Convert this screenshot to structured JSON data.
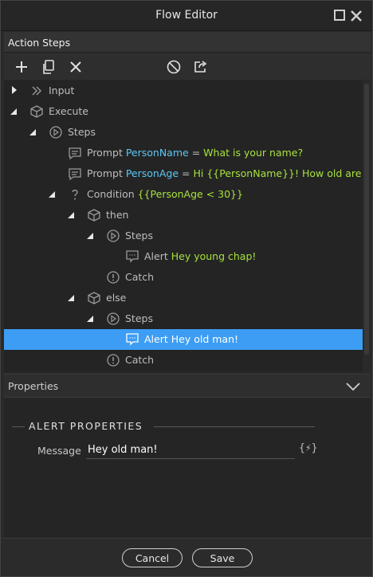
{
  "window": {
    "title": "Flow Editor"
  },
  "steps_panel": {
    "title": "Action Steps"
  },
  "toolbar": {
    "buttons": [
      {
        "icon": "plus-icon"
      },
      {
        "icon": "copy-icon"
      },
      {
        "icon": "close-icon"
      },
      {
        "icon": "disable-icon"
      },
      {
        "icon": "export-icon"
      }
    ]
  },
  "tree": {
    "input": {
      "label": "Input"
    },
    "execute": {
      "label": "Execute"
    },
    "steps": {
      "label": "Steps"
    },
    "prompt1": {
      "keyword": "Prompt",
      "variable": "PersonName",
      "eq": "=",
      "value": "What is your name?"
    },
    "prompt2": {
      "keyword": "Prompt",
      "variable": "PersonAge",
      "eq": "=",
      "value": "Hi {{PersonName}}! How old are you?"
    },
    "condition": {
      "keyword": "Condition",
      "value": "{{PersonAge < 30}}"
    },
    "then": {
      "label": "then"
    },
    "then_steps": {
      "label": "Steps"
    },
    "alert1": {
      "keyword": "Alert",
      "value": "Hey young chap!"
    },
    "then_catch": {
      "label": "Catch"
    },
    "else": {
      "label": "else"
    },
    "else_steps": {
      "label": "Steps"
    },
    "alert2": {
      "keyword": "Alert",
      "value": "Hey old man!"
    },
    "else_catch": {
      "label": "Catch"
    }
  },
  "properties": {
    "header": "Properties",
    "group_title": "ALERT PROPERTIES",
    "message_label": "Message",
    "message_value": "Hey old man!",
    "dynamic_symbol": "{⚡}"
  },
  "footer": {
    "cancel_label": "Cancel",
    "save_label": "Save"
  },
  "colors": {
    "accent": "#3d9df4",
    "variable": "#5bc8f5",
    "value": "#a8e23d"
  }
}
